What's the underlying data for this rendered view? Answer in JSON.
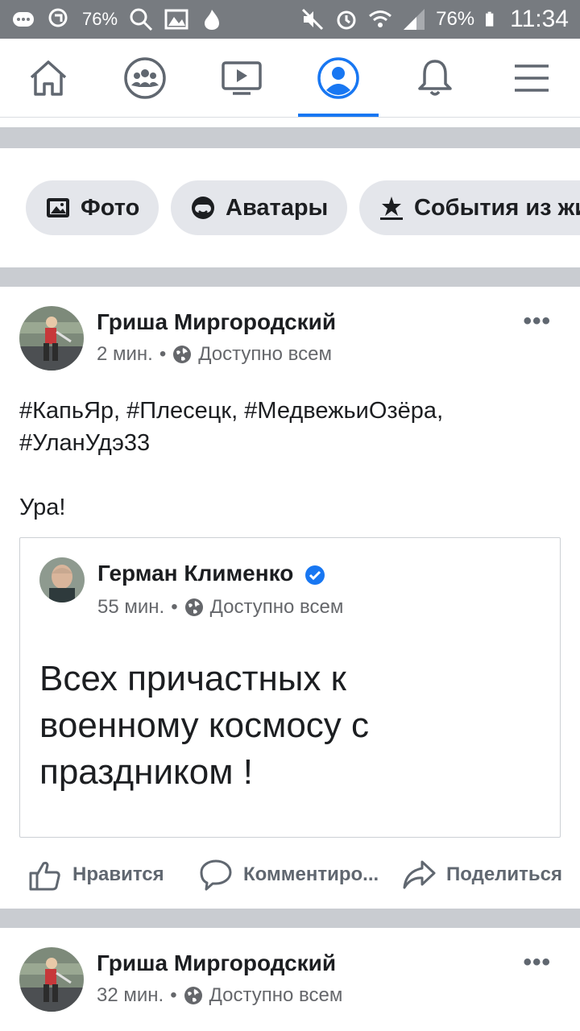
{
  "status_bar": {
    "battery_left": "76%",
    "battery_right": "76%",
    "time": "11:34"
  },
  "nav": {
    "items": [
      {
        "name": "home",
        "icon": "home-icon"
      },
      {
        "name": "groups",
        "icon": "groups-icon"
      },
      {
        "name": "watch",
        "icon": "video-icon"
      },
      {
        "name": "profile",
        "icon": "profile-icon",
        "active": true
      },
      {
        "name": "notifications",
        "icon": "bell-icon"
      },
      {
        "name": "menu",
        "icon": "hamburger-icon"
      }
    ],
    "accent": "#1877f2"
  },
  "chips": [
    {
      "label": "Фото",
      "icon": "photo-icon"
    },
    {
      "label": "Аватары",
      "icon": "avatar-face-icon"
    },
    {
      "label": "События из жизни",
      "icon": "star-flag-icon"
    }
  ],
  "post1": {
    "author": "Гриша Миргородский",
    "time": "2 мин.",
    "audience": "Доступно всем",
    "text_line1": "#КапьЯр, #Плесецк, #МедвежьиОзёра,",
    "text_line2": "#УланУдэ33",
    "text_line3": "Ура!",
    "shared": {
      "author": "Герман Клименко",
      "time": "55 мин.",
      "audience": "Доступно всем",
      "text_line1": "Всех причастных к",
      "text_line2": "военному космосу с",
      "text_line3": "праздником !"
    },
    "actions": {
      "like": "Нравится",
      "comment": "Комментиро...",
      "share": "Поделиться"
    }
  },
  "post2": {
    "author": "Гриша Миргородский",
    "time": "32 мин.",
    "audience": "Доступно всем"
  },
  "more_label": "•••",
  "dot": "•"
}
